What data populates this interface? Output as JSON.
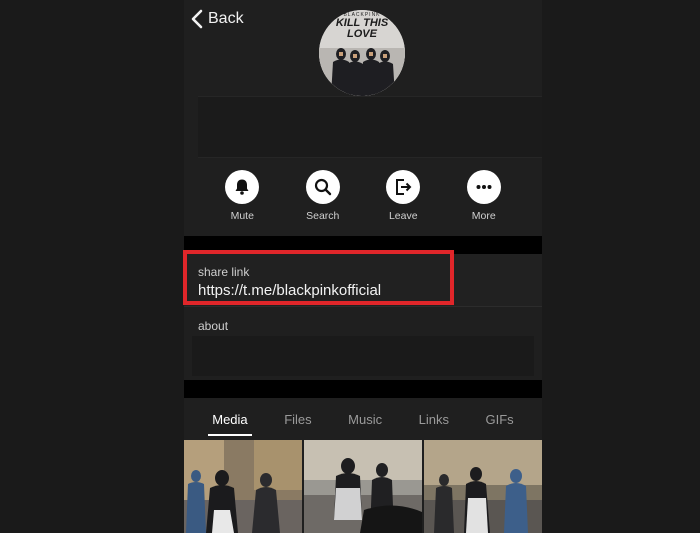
{
  "header": {
    "back_label": "Back"
  },
  "channel": {
    "avatar_text": "KILL THIS LOVE",
    "avatar_small_text": "BLACKPINK"
  },
  "actions": [
    {
      "label": "Mute",
      "icon": "bell-icon"
    },
    {
      "label": "Search",
      "icon": "search-icon"
    },
    {
      "label": "Leave",
      "icon": "leave-icon"
    },
    {
      "label": "More",
      "icon": "more-icon"
    }
  ],
  "info": {
    "share_link_label": "share link",
    "share_link_url": "https://t.me/blackpinkofficial",
    "about_label": "about"
  },
  "tabs": [
    {
      "label": "Media",
      "active": true
    },
    {
      "label": "Files",
      "active": false
    },
    {
      "label": "Music",
      "active": false
    },
    {
      "label": "Links",
      "active": false
    },
    {
      "label": "GIFs",
      "active": false
    }
  ],
  "colors": {
    "highlight": "#e0262a",
    "background": "#1f1f1f"
  }
}
